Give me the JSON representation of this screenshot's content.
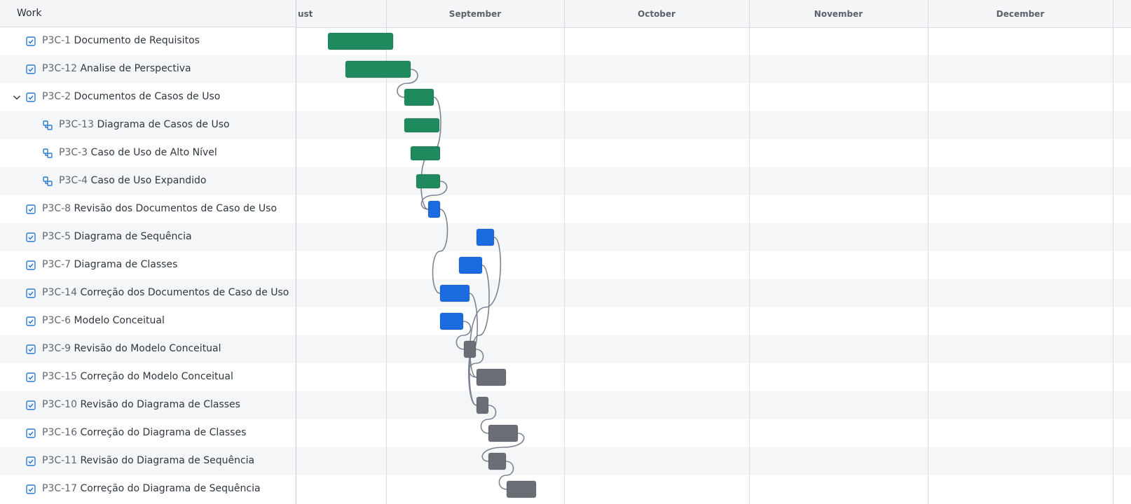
{
  "header": {
    "work_label": "Work"
  },
  "months": [
    {
      "label": "ust"
    },
    {
      "label": "September"
    },
    {
      "label": "October"
    },
    {
      "label": "November"
    },
    {
      "label": "December"
    }
  ],
  "colors": {
    "done": "#1f8a5e",
    "in_progress": "#1a6bdf",
    "todo": "#6b6e77",
    "link": "#7c8494"
  },
  "tasks": [
    {
      "key": "P3C-1",
      "title": "Documento de Requisitos",
      "type": "task",
      "status": "done"
    },
    {
      "key": "P3C-12",
      "title": "Analise de Perspectiva",
      "type": "task",
      "status": "done"
    },
    {
      "key": "P3C-2",
      "title": "Documentos de Casos de Uso",
      "type": "task",
      "status": "done",
      "expanded": true
    },
    {
      "key": "P3C-13",
      "title": "Diagrama de Casos de Uso",
      "type": "subtask",
      "status": "done"
    },
    {
      "key": "P3C-3",
      "title": "Caso de Uso de Alto Nível",
      "type": "subtask",
      "status": "done"
    },
    {
      "key": "P3C-4",
      "title": "Caso de Uso Expandido",
      "type": "subtask",
      "status": "done"
    },
    {
      "key": "P3C-8",
      "title": "Revisão dos Documentos de Caso de Uso",
      "type": "task",
      "status": "in_progress"
    },
    {
      "key": "P3C-5",
      "title": "Diagrama de Sequência",
      "type": "task",
      "status": "in_progress"
    },
    {
      "key": "P3C-7",
      "title": "Diagrama de Classes",
      "type": "task",
      "status": "in_progress"
    },
    {
      "key": "P3C-14",
      "title": "Correção dos Documentos de Caso de Uso",
      "type": "task",
      "status": "in_progress"
    },
    {
      "key": "P3C-6",
      "title": "Modelo Conceitual",
      "type": "task",
      "status": "in_progress"
    },
    {
      "key": "P3C-9",
      "title": "Revisão do Modelo Conceitual",
      "type": "task",
      "status": "todo"
    },
    {
      "key": "P3C-15",
      "title": "Correção do Modelo Conceitual",
      "type": "task",
      "status": "todo"
    },
    {
      "key": "P3C-10",
      "title": "Revisão do Diagrama de Classes",
      "type": "task",
      "status": "todo"
    },
    {
      "key": "P3C-16",
      "title": "Correção do Diagrama de Classes",
      "type": "task",
      "status": "todo"
    },
    {
      "key": "P3C-11",
      "title": "Revisão do Diagrama de Sequência",
      "type": "task",
      "status": "todo"
    },
    {
      "key": "P3C-17",
      "title": "Correção do Diagrama de Sequência",
      "type": "task",
      "status": "todo"
    }
  ]
}
